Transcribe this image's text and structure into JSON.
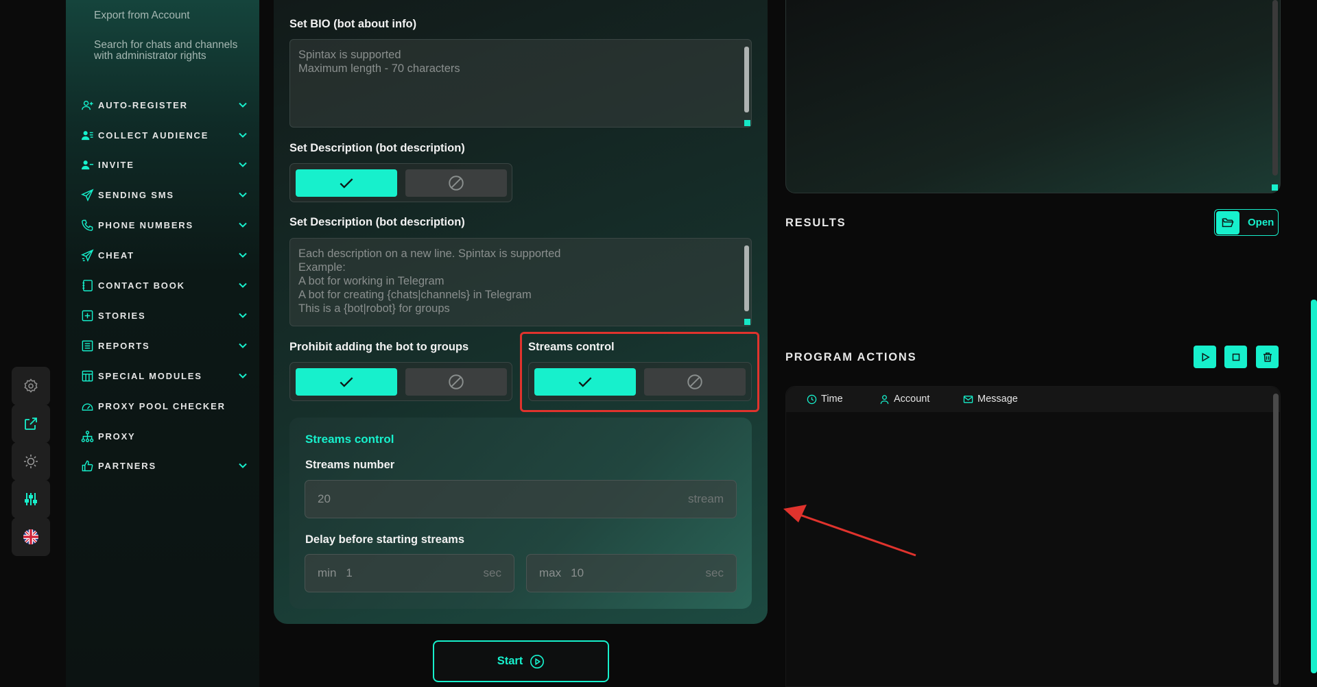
{
  "sidebar": {
    "sub_items": [
      "Export from Account",
      "Search for chats and channels with administrator rights"
    ],
    "items": [
      {
        "label": "AUTO-REGISTER",
        "icon": "user-add-icon",
        "has_chevron": true
      },
      {
        "label": "COLLECT AUDIENCE",
        "icon": "users-icon",
        "has_chevron": true
      },
      {
        "label": "INVITE",
        "icon": "user-invite-icon",
        "has_chevron": true
      },
      {
        "label": "SENDING SMS",
        "icon": "paper-plane-icon",
        "has_chevron": true
      },
      {
        "label": "PHONE NUMBERS",
        "icon": "phone-icon",
        "has_chevron": true
      },
      {
        "label": "CHEAT",
        "icon": "send-boost-icon",
        "has_chevron": true
      },
      {
        "label": "CONTACT BOOK",
        "icon": "book-icon",
        "has_chevron": true
      },
      {
        "label": "STORIES",
        "icon": "plus-square-icon",
        "has_chevron": true
      },
      {
        "label": "REPORTS",
        "icon": "report-icon",
        "has_chevron": true
      },
      {
        "label": "SPECIAL MODULES",
        "icon": "modules-icon",
        "has_chevron": true
      },
      {
        "label": "PROXY POOL CHECKER",
        "icon": "gauge-icon",
        "has_chevron": false
      },
      {
        "label": "PROXY",
        "icon": "network-icon",
        "has_chevron": false
      },
      {
        "label": "PARTNERS",
        "icon": "thumbs-up-icon",
        "has_chevron": true
      }
    ]
  },
  "rail": {
    "buttons": [
      "settings-gear-icon",
      "external-link-icon",
      "theme-sun-icon",
      "sliders-icon",
      "uk-flag-icon"
    ]
  },
  "form": {
    "bio_label": "Set BIO (bot about info)",
    "bio_placeholder": "Spintax is supported\nMaximum length - 70 characters",
    "desc_toggle_label": "Set Description (bot description)",
    "desc_text_label": "Set Description (bot description)",
    "desc_placeholder": "Each description on a new line. Spintax is supported\nExample:\nA bot for working in Telegram\nA bot for creating {chats|channels} in Telegram\nThis is a {bot|robot} for groups",
    "prohibit_label": "Prohibit adding the bot to groups",
    "streams_label": "Streams control",
    "streams_card": {
      "title": "Streams control",
      "number_label": "Streams number",
      "number_value": "20",
      "number_unit": "stream",
      "delay_label": "Delay before starting streams",
      "min_prefix": "min",
      "min_value": "1",
      "min_unit": "sec",
      "max_prefix": "max",
      "max_value": "10",
      "max_unit": "sec"
    },
    "start_label": "Start"
  },
  "results": {
    "title": "RESULTS",
    "open_label": "Open"
  },
  "program_actions": {
    "title": "PROGRAM ACTIONS",
    "columns": [
      "Time",
      "Account",
      "Message"
    ]
  },
  "colors": {
    "accent": "#17f0cc",
    "highlight": "#e0332d"
  }
}
